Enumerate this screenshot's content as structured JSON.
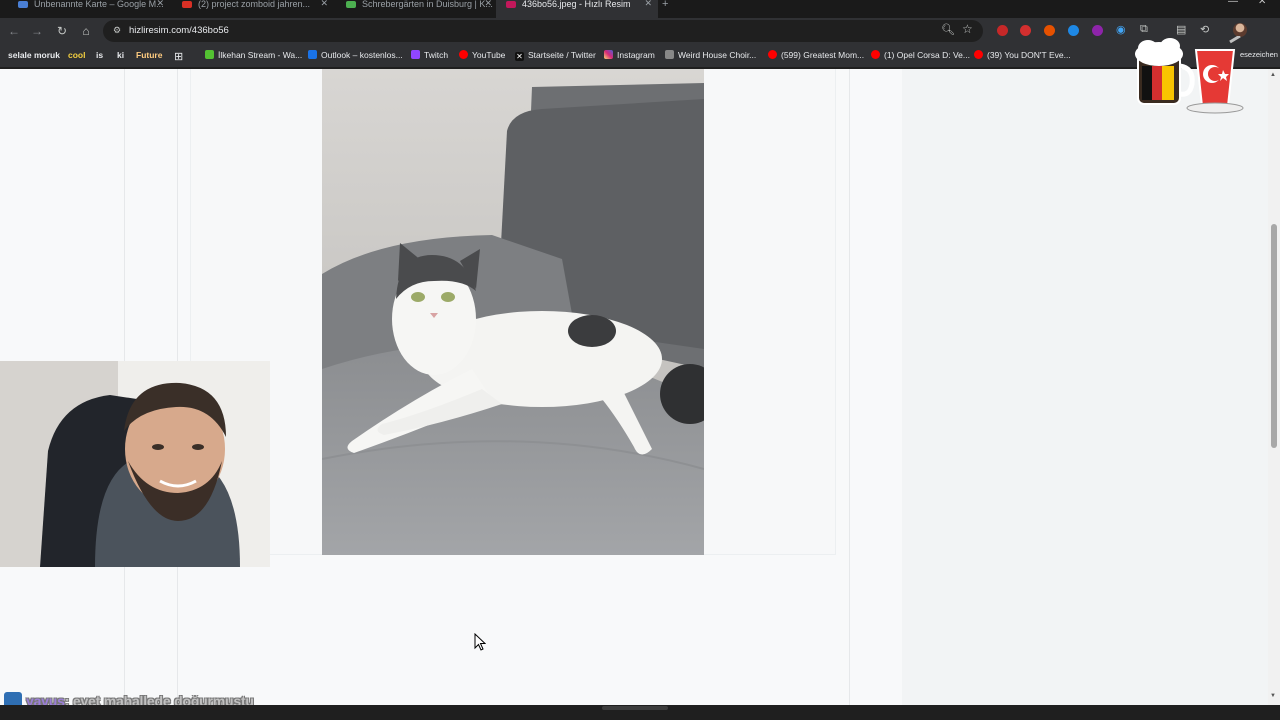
{
  "browser": {
    "tabs": [
      {
        "title": "Unbenannte Karte – Google M...",
        "color": "#4a7fd4",
        "active": false
      },
      {
        "title": "(2) project zomboid jahren...",
        "color": "#d93025",
        "active": false
      },
      {
        "title": "Schrebergärten in Duisburg | K...",
        "color": "#4caf50",
        "active": false
      },
      {
        "title": "436bo56.jpeg - Hızlı Resim",
        "color": "#c2185b",
        "active": true
      }
    ],
    "url": "hizliresim.com/436bo56",
    "bookmarks": [
      {
        "label": "selale moruk",
        "color": "#303134",
        "folder": true
      },
      {
        "label": "cool",
        "color": "#303134",
        "folder": true
      },
      {
        "label": "is",
        "color": "#303134",
        "folder": true
      },
      {
        "label": "ki",
        "color": "#303134",
        "folder": true
      },
      {
        "label": "Future",
        "color": "#303134",
        "folder": true
      },
      {
        "label": "İlkehan Stream - Wa...",
        "color": "#53c232"
      },
      {
        "label": "Outlook – kostenlos...",
        "color": "#1a73e8"
      },
      {
        "label": "Twitch",
        "color": "#9146ff"
      },
      {
        "label": "YouTube",
        "color": "#ff0000"
      },
      {
        "label": "Startseite / Twitter",
        "color": "#111111"
      },
      {
        "label": "Instagram",
        "color": "#e1306c"
      },
      {
        "label": "Weird House Choir...",
        "color": "#888888"
      },
      {
        "label": "(599) Greatest Mom...",
        "color": "#ff0000"
      },
      {
        "label": "(1) Opel Corsa D: Ve...",
        "color": "#ff0000"
      },
      {
        "label": "(39) You DON'T Eve...",
        "color": "#ff0000"
      }
    ],
    "other_bookmarks": "esezeichen"
  },
  "stream_overlay": {
    "chat_user": "yavus",
    "chat_message": ": evet mahallede doğurmuştu"
  },
  "image_alt": "436bo56.jpeg"
}
